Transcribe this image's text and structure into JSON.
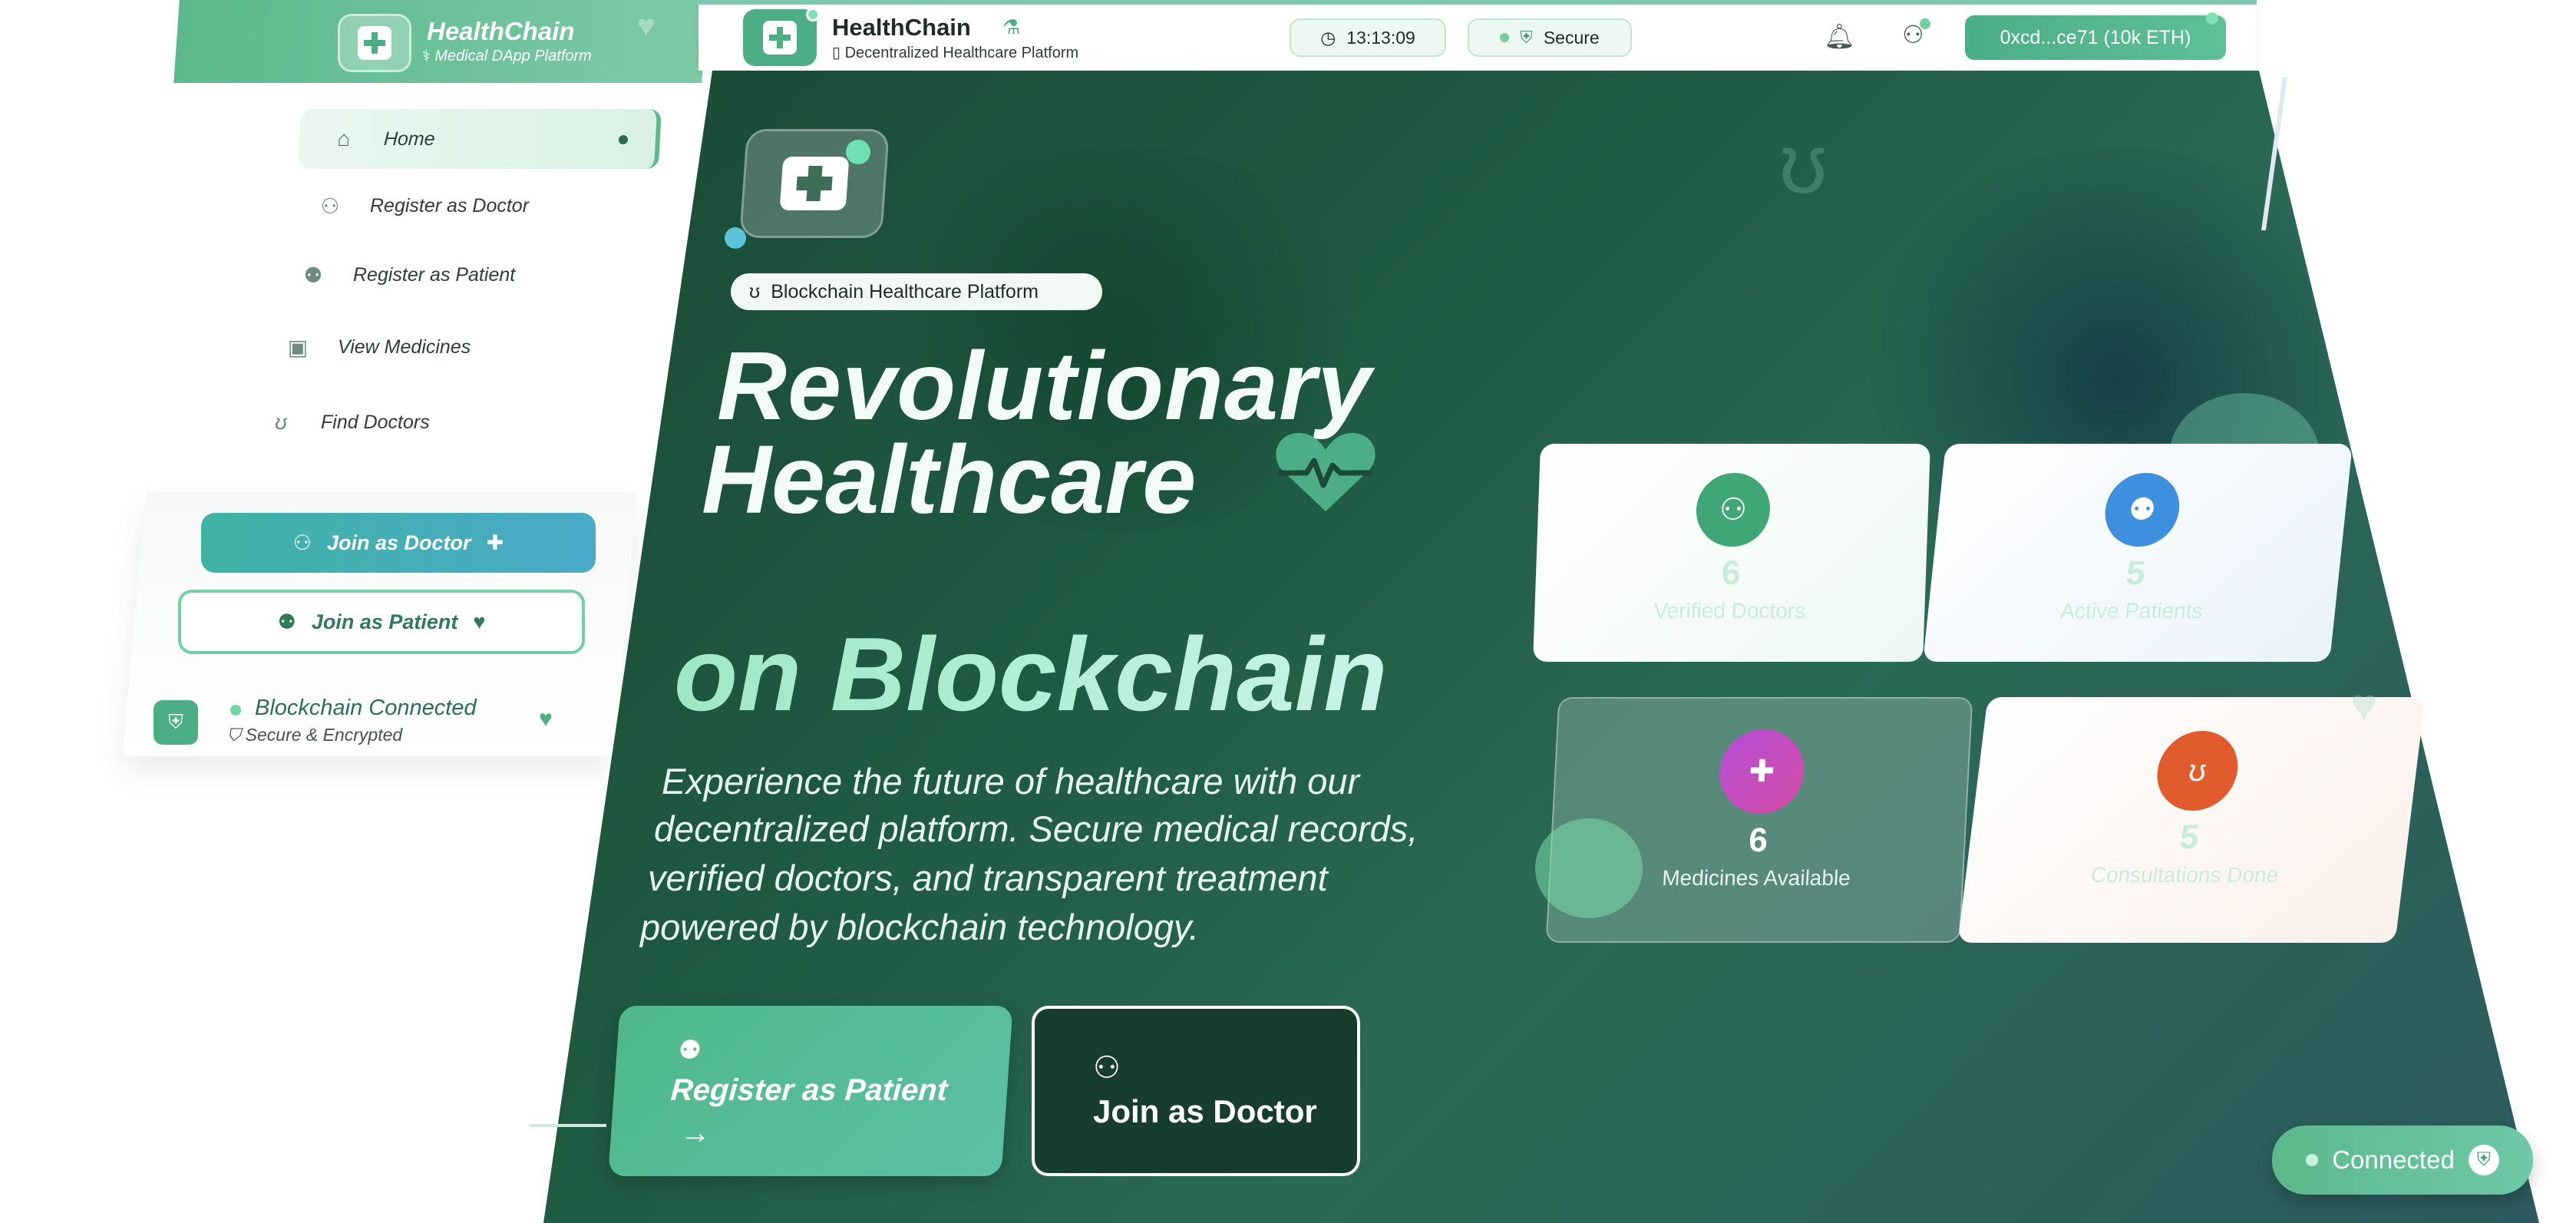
{
  "sidebar": {
    "brand_title": "HealthChain",
    "brand_subtitle": "Medical DApp Platform",
    "nav": [
      {
        "label": "Home",
        "icon": "home-icon"
      },
      {
        "label": "Register as Doctor",
        "icon": "doctor-icon"
      },
      {
        "label": "Register as Patient",
        "icon": "patients-icon"
      },
      {
        "label": "View Medicines",
        "icon": "medicine-icon"
      },
      {
        "label": "Find Doctors",
        "icon": "stethoscope-icon"
      }
    ],
    "join_doctor": "Join as Doctor",
    "join_patient": "Join as Patient",
    "blockchain_status": "Blockchain Connected",
    "blockchain_sub": "Secure & Encrypted"
  },
  "topbar": {
    "title": "HealthChain",
    "subtitle": "Decentralized Healthcare Platform",
    "time": "13:13:09",
    "secure": "Secure",
    "wallet": "0xcd...ce71 (10k ETH)"
  },
  "hero": {
    "badge": "Blockchain Healthcare Platform",
    "headline_1": "Revolutionary",
    "headline_2": "Healthcare",
    "headline_3": "on Blockchain",
    "desc_1": "Experience the future of healthcare with our",
    "desc_2": "decentralized platform. Secure medical records,",
    "desc_3": "verified doctors, and transparent treatment",
    "desc_4": "powered by blockchain technology.",
    "cta_patient": "Register as Patient",
    "cta_doctor": "Join as Doctor"
  },
  "stats": [
    {
      "value": "6",
      "label": "Verified Doctors",
      "icon": "doctor-icon",
      "color": "#3fa776"
    },
    {
      "value": "5",
      "label": "Active Patients",
      "icon": "patients-icon",
      "color": "#3f8fe0"
    },
    {
      "value": "6",
      "label": "Medicines Available",
      "icon": "medicine-icon",
      "color": "#c24ec8"
    },
    {
      "value": "5",
      "label": "Consultations Done",
      "icon": "stethoscope-icon",
      "color": "#e25b2c"
    }
  ],
  "connection": {
    "label": "Connected"
  },
  "colors": {
    "accent": "#4cae86",
    "hero_bg": "#1f5a43"
  }
}
